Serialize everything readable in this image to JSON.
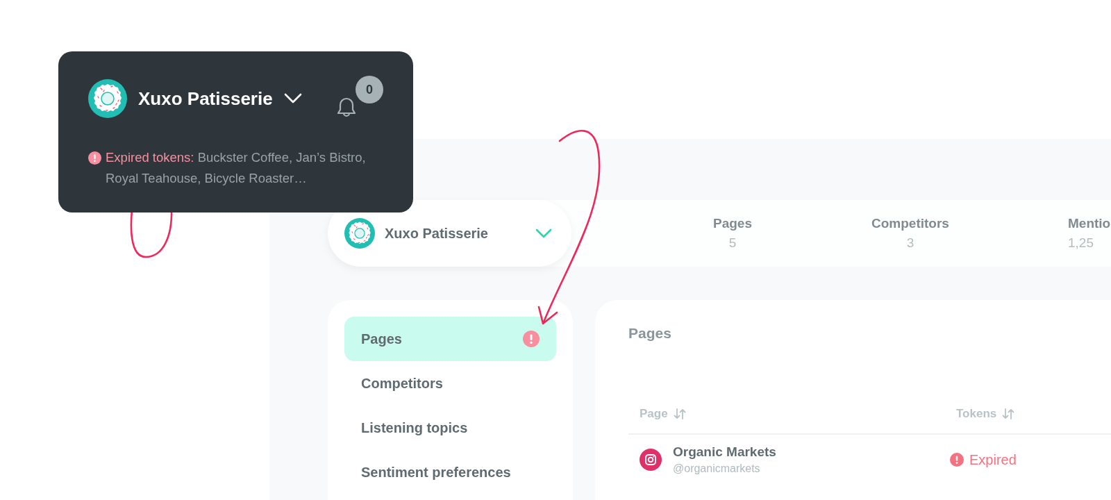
{
  "account_card": {
    "name": "Xuxo Patisserie",
    "notification_count": "0",
    "alert_label": "Expired tokens:",
    "alert_text": "Buckster Coffee, Jan’s Bistro, Royal Teahouse, Bicycle Roaster…"
  },
  "header": {
    "account_name": "Xuxo Patisserie",
    "stats": [
      {
        "label": "Pages",
        "value": "5"
      },
      {
        "label": "Competitors",
        "value": "3"
      },
      {
        "label": "Mentio",
        "value": "1,25"
      }
    ]
  },
  "sidebar": {
    "items": [
      {
        "label": "Pages",
        "selected": true,
        "alert": true
      },
      {
        "label": "Competitors",
        "selected": false,
        "alert": false
      },
      {
        "label": "Listening topics",
        "selected": false,
        "alert": false
      },
      {
        "label": "Sentiment preferences",
        "selected": false,
        "alert": false
      }
    ]
  },
  "pages_panel": {
    "title": "Pages",
    "columns": [
      "Page",
      "Tokens"
    ],
    "rows": [
      {
        "name": "Organic Markets",
        "handle": "@organicmarkets",
        "kind": "instagram",
        "token_expired": true,
        "token_status": "Expired"
      }
    ]
  }
}
